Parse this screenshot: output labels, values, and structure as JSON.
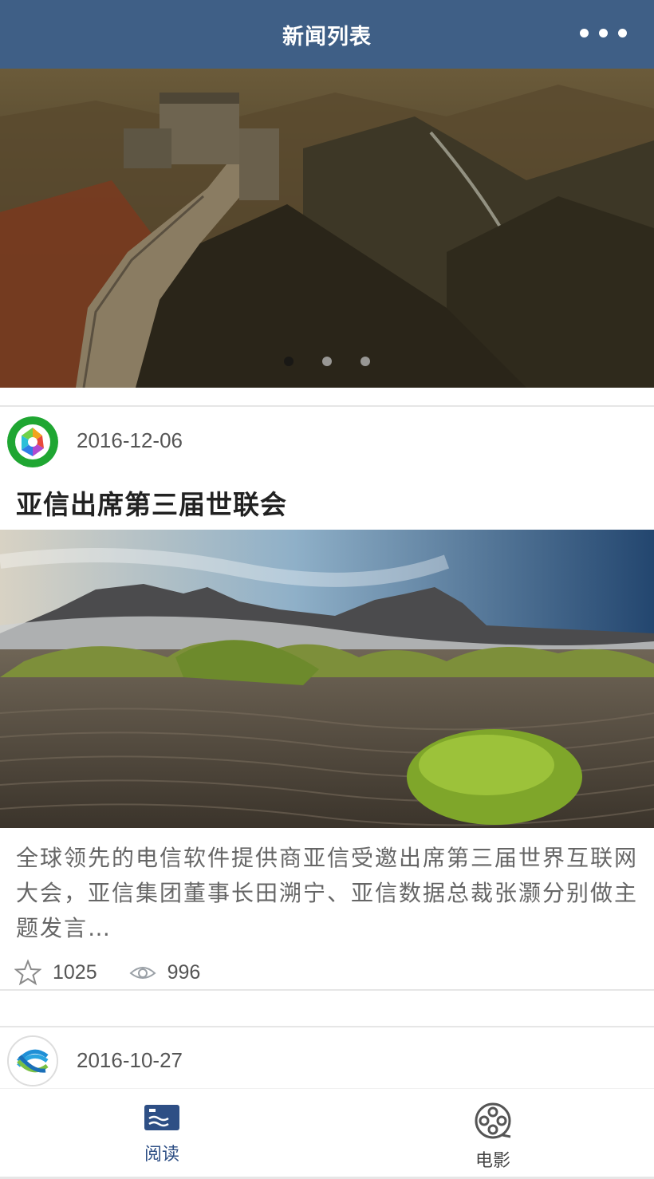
{
  "nav": {
    "title": "新闻列表"
  },
  "banner": {
    "slide_count": 3,
    "active_index": 0
  },
  "posts": [
    {
      "date": "2016-12-06",
      "title": "亚信出席第三届世联会",
      "content": "全球领先的电信软件提供商亚信受邀出席第三届世界互联网大会，亚信集团董事长田溯宁、亚信数据总裁张灏分别做主题发言…",
      "collect_count": "1025",
      "view_count": "996",
      "avatar_icon": "aperture-icon"
    },
    {
      "date": "2016-10-27",
      "avatar_icon": "china-mobile-logo-icon"
    }
  ],
  "tabs": [
    {
      "label": "阅读",
      "icon": "reading-icon",
      "active": true
    },
    {
      "label": "电影",
      "icon": "film-reel-icon",
      "active": false
    }
  ],
  "colors": {
    "nav_bg": "#3f5f86",
    "tab_active": "#2e4f85"
  }
}
